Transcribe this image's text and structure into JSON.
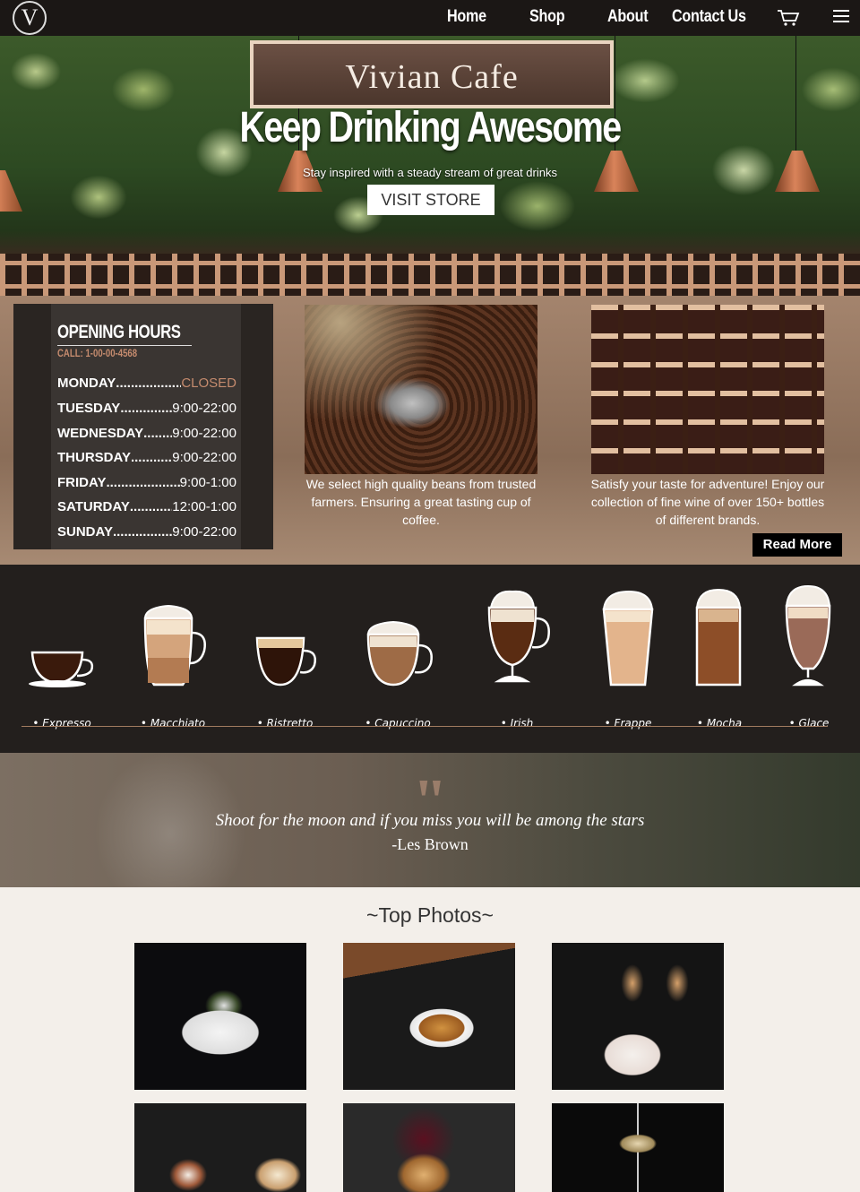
{
  "nav": {
    "logo": "V",
    "links": [
      "Home",
      "Shop",
      "About",
      "Contact Us"
    ],
    "cart_icon": "cart-icon",
    "menu_icon": "hamburger-icon"
  },
  "hero": {
    "title": "Vivian Cafe",
    "tagline": "Keep Drinking Awesome",
    "subtitle": "Stay inspired with a steady stream of great drinks",
    "button": "VISIT STORE"
  },
  "hours": {
    "title": "OPENING HOURS",
    "call": "CALL: 1-00-00-4568",
    "rows": [
      {
        "day": "MONDAY",
        "time": "CLOSED"
      },
      {
        "day": "TUESDAY",
        "time": "9:00-22:00"
      },
      {
        "day": "WEDNESDAY",
        "time": "9:00-22:00"
      },
      {
        "day": "THURSDAY",
        "time": "9:00-22:00"
      },
      {
        "day": "FRIDAY",
        "time": "9:00-1:00"
      },
      {
        "day": "SATURDAY",
        "time": "12:00-1:00"
      },
      {
        "day": "SUNDAY",
        "time": "9:00-22:00"
      }
    ]
  },
  "cards": {
    "beans_text": "We select high quality beans from trusted farmers. Ensuring a great tasting cup of coffee.",
    "wine_text": "Satisfy your taste for adventure! Enjoy our collection of fine wine of over 150+ bottles of different brands.",
    "read_more": "Read More"
  },
  "drinks": [
    "Expresso",
    "Macchiato",
    "Ristretto",
    "Capuccino",
    "Irish",
    "Frappe",
    "Mocha",
    "Glace"
  ],
  "quote": {
    "mark": "\"",
    "text": "Shoot for the moon and if you miss you will be among the stars",
    "author": "-Les Brown"
  },
  "photos": {
    "title": "~Top Photos~"
  },
  "colors": {
    "nav_bg": "#1b1715",
    "accent": "#c58b6e",
    "drinks_bg": "#231f1d"
  }
}
